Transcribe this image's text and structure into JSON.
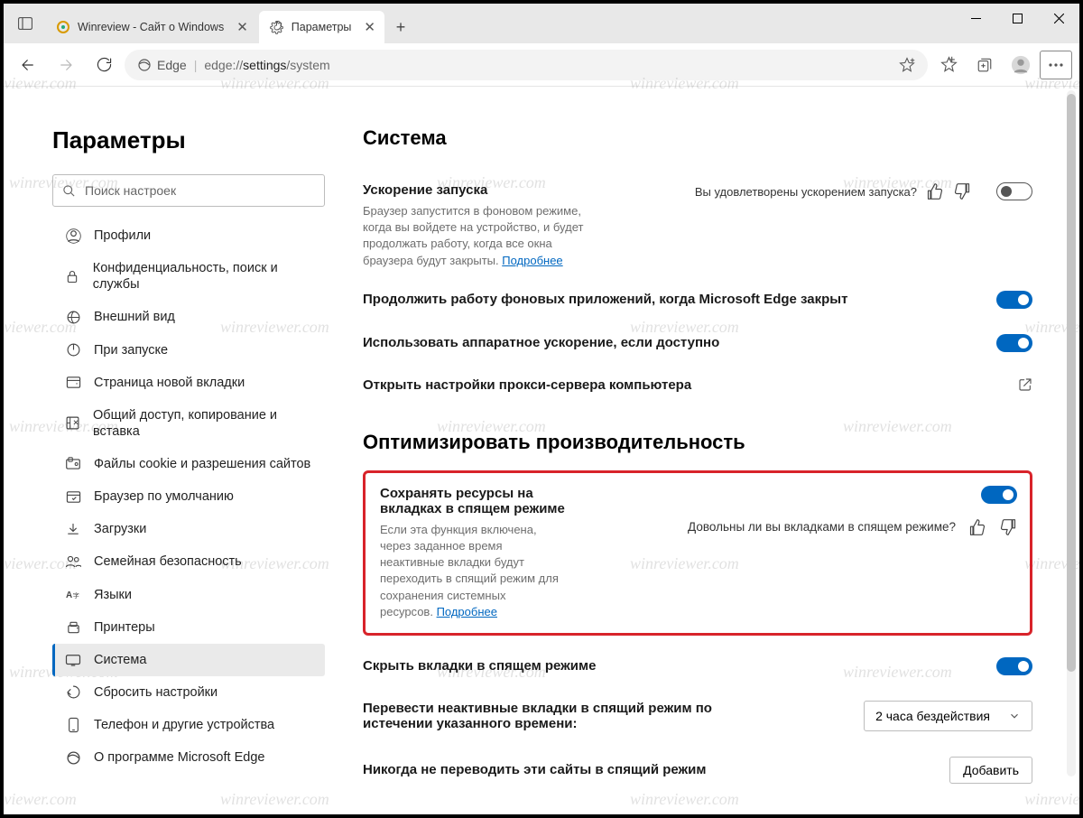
{
  "watermark": "winreviewer.com",
  "tabs": [
    {
      "title": "Winreview - Сайт о Windows",
      "active": false
    },
    {
      "title": "Параметры",
      "active": true
    }
  ],
  "address": {
    "chip": "Edge",
    "url_prefix": "edge://",
    "url_mid": "settings",
    "url_suffix": "/system"
  },
  "sidebar": {
    "heading": "Параметры",
    "search_placeholder": "Поиск настроек",
    "items": [
      "Профили",
      "Конфиденциальность, поиск и службы",
      "Внешний вид",
      "При запуске",
      "Страница новой вкладки",
      "Общий доступ, копирование и вставка",
      "Файлы cookie и разрешения сайтов",
      "Браузер по умолчанию",
      "Загрузки",
      "Семейная безопасность",
      "Языки",
      "Принтеры",
      "Система",
      "Сбросить настройки",
      "Телефон и другие устройства",
      "О программе Microsoft Edge"
    ],
    "active_index": 12
  },
  "main": {
    "heading": "Система",
    "startup": {
      "title": "Ускорение запуска",
      "desc": "Браузер запустится в фоновом режиме, когда вы войдете на устройство, и будет продолжать работу, когда все окна браузера будут закрыты. ",
      "link": "Подробнее",
      "feedback": "Вы удовлетворены ускорением запуска?",
      "toggle": false
    },
    "bgapps": {
      "title": "Продолжить работу фоновых приложений, когда Microsoft Edge закрыт",
      "toggle": true
    },
    "hwaccel": {
      "title": "Использовать аппаратное ускорение, если доступно",
      "toggle": true
    },
    "proxy": {
      "title": "Открыть настройки прокси-сервера компьютера"
    },
    "perf_heading": "Оптимизировать производительность",
    "sleep": {
      "title": "Сохранять ресурсы на вкладках в спящем режиме",
      "desc": "Если эта функция включена, через заданное время неактивные вкладки будут переходить в спящий режим для сохранения системных ресурсов. ",
      "link": "Подробнее",
      "feedback": "Довольны ли вы вкладками в спящем режиме?",
      "toggle": true
    },
    "fade": {
      "title": "Скрыть вкладки в спящем режиме",
      "toggle": true
    },
    "timeout": {
      "title": "Перевести неактивные вкладки в спящий режим по истечении указанного времени:",
      "value": "2 часа бездействия"
    },
    "never": {
      "title": "Никогда не переводить эти сайты в спящий режим",
      "button": "Добавить"
    }
  }
}
